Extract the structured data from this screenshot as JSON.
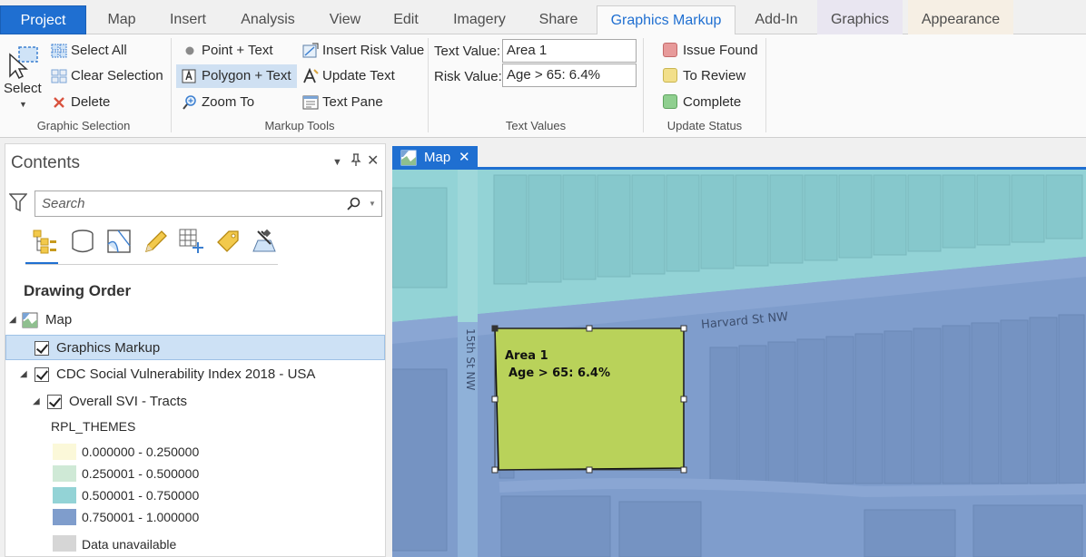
{
  "tabs": [
    "Project",
    "Map",
    "Insert",
    "Analysis",
    "View",
    "Edit",
    "Imagery",
    "Share",
    "Graphics Markup",
    "Add-In",
    "Graphics",
    "Appearance"
  ],
  "active_tab": "Graphics Markup",
  "ribbon": {
    "graphic_selection": {
      "label": "Graphic Selection",
      "select": "Select",
      "select_all": "Select All",
      "clear_selection": "Clear Selection",
      "delete": "Delete"
    },
    "markup_tools": {
      "label": "Markup Tools",
      "point_text": "Point + Text",
      "polygon_text": "Polygon + Text",
      "zoom_to": "Zoom To",
      "insert_risk_value": "Insert Risk Value",
      "update_text": "Update Text",
      "text_pane": "Text Pane"
    },
    "text_values": {
      "label": "Text Values",
      "text_value_label": "Text Value:",
      "text_value": "Area 1",
      "risk_value_label": "Risk Value:",
      "risk_value": "Age > 65:  6.4%"
    },
    "update_status": {
      "label": "Update Status",
      "issue_found": "Issue Found",
      "to_review": "To Review",
      "complete": "Complete",
      "colors": {
        "issue_found": "#e79a9a",
        "to_review": "#f2df8a",
        "complete": "#8fcf8f"
      }
    }
  },
  "contents": {
    "title": "Contents",
    "search_placeholder": "Search",
    "drawing_order": "Drawing Order",
    "tree": {
      "map": "Map",
      "graphics_markup": "Graphics Markup",
      "cdc_layer": "CDC Social Vulnerability Index 2018 - USA",
      "svi_tracts": "Overall SVI - Tracts",
      "field": "RPL_THEMES"
    },
    "legend": [
      {
        "label": "0.000000 - 0.250000",
        "color": "#fbf8d9"
      },
      {
        "label": "0.250001 - 0.500000",
        "color": "#cfe9d6"
      },
      {
        "label": "0.500001 - 0.750000",
        "color": "#93d3d6"
      },
      {
        "label": "0.750001 - 1.000000",
        "color": "#7f9dcc"
      },
      {
        "label": "Data unavailable",
        "color": "#d6d6d6"
      }
    ]
  },
  "map": {
    "tab_label": "Map",
    "street_ew": "Harvard St NW",
    "street_ns": "15th St NW",
    "annotation_title": "Area 1",
    "annotation_value": "Age > 65:  6.4%"
  }
}
